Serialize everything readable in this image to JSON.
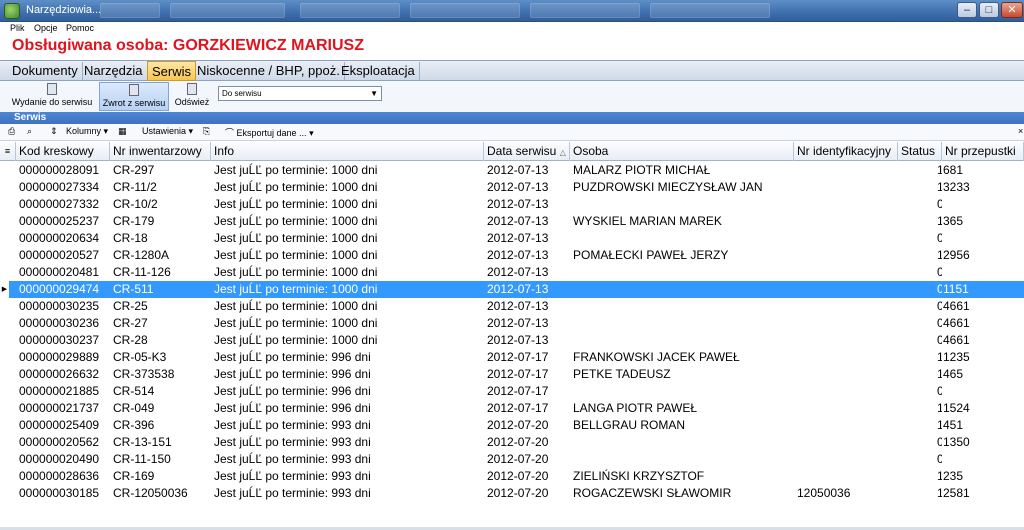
{
  "window": {
    "title": "Narzędziowia..."
  },
  "menu": {
    "items": [
      "Plik",
      "Opcje",
      "Pomoc"
    ]
  },
  "person": {
    "label": "Obsługiwana osoba: GORZKIEWICZ MARIUSZ"
  },
  "tabs": [
    {
      "label": "Dokumenty"
    },
    {
      "label": "Narzędzia"
    },
    {
      "label": "Serwis",
      "active": true
    },
    {
      "label": "Niskocenne / BHP, ppoż."
    },
    {
      "label": "Eksploatacja"
    }
  ],
  "ribbon": {
    "issue_label": "Wydanie do serwisu",
    "return_label": "Zwrot z serwisu",
    "refresh_label": "Odśwież",
    "select_value": "Do serwisu"
  },
  "panel": {
    "title": "Serwis"
  },
  "toolbar": {
    "columns_label": "Kolumny",
    "settings_label": "Ustawienia",
    "export_label": "Eksportuj dane ..."
  },
  "grid": {
    "headers": [
      "Kod kreskowy",
      "Nr inwentarzowy",
      "Info",
      "Data serwisu",
      "Osoba",
      "Nr identyfikacyjny",
      "Status",
      "Nr przepustki"
    ],
    "rows": [
      [
        "000000028091",
        "CR-297",
        "Jest juĹĽ po terminie: 1000 dni",
        "2012-07-13",
        "MALARZ PIOTR MICHAŁ",
        "",
        "1",
        "681"
      ],
      [
        "000000027334",
        "CR-11/2",
        "Jest juĹĽ po terminie: 1000 dni",
        "2012-07-13",
        "PUZDROWSKI MIECZYSŁAW JAN",
        "",
        "1",
        "3233"
      ],
      [
        "000000027332",
        "CR-10/2",
        "Jest juĹĽ po terminie: 1000 dni",
        "2012-07-13",
        "",
        "",
        "0",
        ""
      ],
      [
        "000000025237",
        "CR-179",
        "Jest juĹĽ po terminie: 1000 dni",
        "2012-07-13",
        "WYSKIEL MARIAN MAREK",
        "",
        "1",
        "365"
      ],
      [
        "000000020634",
        "CR-18",
        "Jest juĹĽ po terminie: 1000 dni",
        "2012-07-13",
        "",
        "",
        "0",
        ""
      ],
      [
        "000000020527",
        "CR-1280A",
        "Jest juĹĽ po terminie: 1000 dni",
        "2012-07-13",
        "POMAŁECKI PAWEŁ JERZY",
        "",
        "1",
        "2956"
      ],
      [
        "000000020481",
        "CR-11-126",
        "Jest juĹĽ po terminie: 1000 dni",
        "2012-07-13",
        "",
        "",
        "0",
        ""
      ],
      [
        "000000029474",
        "CR-511",
        "Jest juĹĽ po terminie: 1000 dni",
        "2012-07-13",
        "",
        "",
        "0",
        "1151"
      ],
      [
        "000000030235",
        "CR-25",
        "Jest juĹĽ po terminie: 1000 dni",
        "2012-07-13",
        "",
        "",
        "0",
        "4661"
      ],
      [
        "000000030236",
        "CR-27",
        "Jest juĹĽ po terminie: 1000 dni",
        "2012-07-13",
        "",
        "",
        "0",
        "4661"
      ],
      [
        "000000030237",
        "CR-28",
        "Jest juĹĽ po terminie: 1000 dni",
        "2012-07-13",
        "",
        "",
        "0",
        "4661"
      ],
      [
        "000000029889",
        "CR-05-K3",
        "Jest juĹĽ po terminie: 996 dni",
        "2012-07-17",
        "FRANKOWSKI JACEK PAWEŁ",
        "",
        "1",
        "1235"
      ],
      [
        "000000026632",
        "CR-373538",
        "Jest juĹĽ po terminie: 996 dni",
        "2012-07-17",
        "PETKE TADEUSZ",
        "",
        "1",
        "465"
      ],
      [
        "000000021885",
        "CR-514",
        "Jest juĹĽ po terminie: 996 dni",
        "2012-07-17",
        "",
        "",
        "0",
        ""
      ],
      [
        "000000021737",
        "CR-049",
        "Jest juĹĽ po terminie: 996 dni",
        "2012-07-17",
        "LANGA PIOTR PAWEŁ",
        "",
        "1",
        "1524"
      ],
      [
        "000000025409",
        "CR-396",
        "Jest juĹĽ po terminie: 993 dni",
        "2012-07-20",
        "BELLGRAU ROMAN",
        "",
        "1",
        "451"
      ],
      [
        "000000020562",
        "CR-13-151",
        "Jest juĹĽ po terminie: 993 dni",
        "2012-07-20",
        "",
        "",
        "0",
        "1350"
      ],
      [
        "000000020490",
        "CR-11-150",
        "Jest juĹĽ po terminie: 993 dni",
        "2012-07-20",
        "",
        "",
        "0",
        ""
      ],
      [
        "000000028636",
        "CR-169",
        "Jest juĹĽ po terminie: 993 dni",
        "2012-07-20",
        "ZIELIŃSKI KRZYSZTOF",
        "",
        "1",
        "235"
      ],
      [
        "000000030185",
        "CR-12050036",
        "Jest juĹĽ po terminie: 993 dni",
        "2012-07-20",
        "ROGACZEWSKI SŁAWOMIR",
        "12050036",
        "1",
        "2581"
      ]
    ],
    "selected_row": 7
  },
  "colors": {
    "selection": "#3399ff",
    "title": "#e0141e",
    "active_tab": "#f7c64f"
  }
}
